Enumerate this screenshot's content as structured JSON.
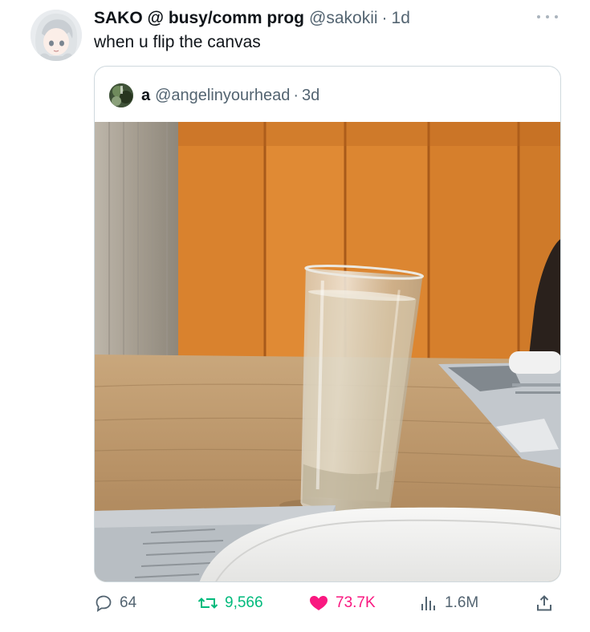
{
  "tweet": {
    "display_name": "SAKO @ busy/comm prog",
    "handle": "@sakokii",
    "separator": "·",
    "time": "1d",
    "text": "when u flip the canvas"
  },
  "quoted": {
    "display_name": "a",
    "handle": "@angelinyourhead",
    "separator": "·",
    "time": "3d"
  },
  "stats": {
    "replies": "64",
    "retweets": "9,566",
    "likes": "73.7K",
    "views": "1.6M"
  },
  "icons": {
    "reply": "reply-icon",
    "retweet": "retweet-icon",
    "like": "heart-icon",
    "views": "views-icon",
    "share": "share-icon",
    "more": "more-icon"
  },
  "colors": {
    "retweet_active": "#00ba7c",
    "like_active": "#f91880",
    "secondary_text": "#536471",
    "quote_border": "#cfd9de"
  }
}
